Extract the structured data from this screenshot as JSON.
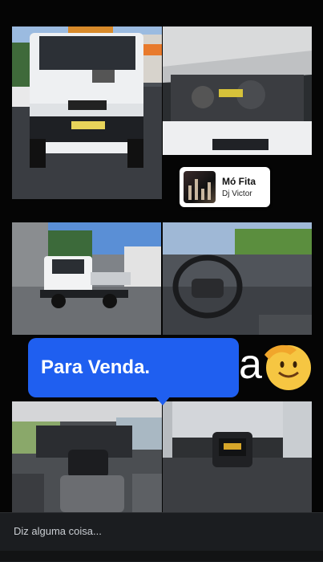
{
  "music_sticker": {
    "title": "Mó Fita",
    "artist": "Dj Victor"
  },
  "speech_bubble": {
    "text": "Para Venda."
  },
  "overlay_text": {
    "letter": "a"
  },
  "reply_bar": {
    "placeholder": "Diz alguma coisa..."
  },
  "photos": [
    {
      "label": "iveco-van-front"
    },
    {
      "label": "engine-bay"
    },
    {
      "label": "tow-truck-side"
    },
    {
      "label": "steering-wheel-interior"
    },
    {
      "label": "rear-seat-interior"
    },
    {
      "label": "cargo-floor-winch"
    }
  ],
  "colors": {
    "bubble": "#1f5ff0",
    "reply_bg": "#1b1d20"
  }
}
